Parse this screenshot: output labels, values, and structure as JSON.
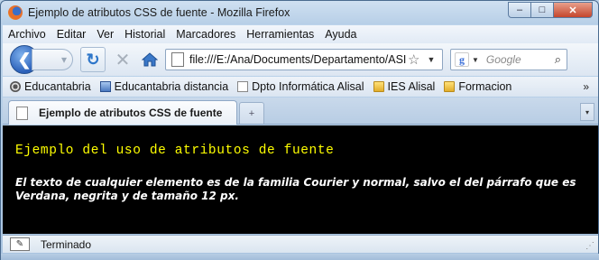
{
  "window": {
    "title": "Ejemplo de atributos CSS de fuente - Mozilla Firefox",
    "app_icon": "firefox-icon",
    "controls": {
      "minimize": "–",
      "maximize": "□",
      "close": "✕"
    }
  },
  "menubar": {
    "items": [
      {
        "label": "Archivo",
        "accel": "A"
      },
      {
        "label": "Editar",
        "accel": "E"
      },
      {
        "label": "Ver",
        "accel": "V"
      },
      {
        "label": "Historial",
        "accel": "s"
      },
      {
        "label": "Marcadores",
        "accel": "M"
      },
      {
        "label": "Herramientas",
        "accel": "t"
      },
      {
        "label": "Ayuda",
        "accel": "y"
      }
    ]
  },
  "navbar": {
    "url": "file:///E:/Ana/Documents/Departamento/ASI",
    "search_placeholder": "Google",
    "search_engine_icon": "google-icon"
  },
  "bookmarks": {
    "items": [
      {
        "label": "Educantabria",
        "icon": "gear-icon"
      },
      {
        "label": "Educantabria distancia",
        "icon": "blue-page-icon"
      },
      {
        "label": "Dpto Informática Alisal",
        "icon": "page-icon"
      },
      {
        "label": "IES Alisal",
        "icon": "folder-icon"
      },
      {
        "label": "Formacion",
        "icon": "folder-icon"
      }
    ],
    "more": "»"
  },
  "tabs": {
    "items": [
      {
        "label": "Ejemplo de atributos CSS de fuente"
      }
    ],
    "new_tab": "+",
    "list": "▾"
  },
  "content": {
    "heading": "Ejemplo del uso de atributos de fuente",
    "paragraph": "El texto de cualquier elemento es de la familia Courier y normal, salvo el del párrafo que es Verdana, negrita y de tamaño 12 px.",
    "colors": {
      "background": "#000000",
      "heading": "#ffff00",
      "paragraph": "#ffffff"
    }
  },
  "statusbar": {
    "text": "Terminado"
  }
}
